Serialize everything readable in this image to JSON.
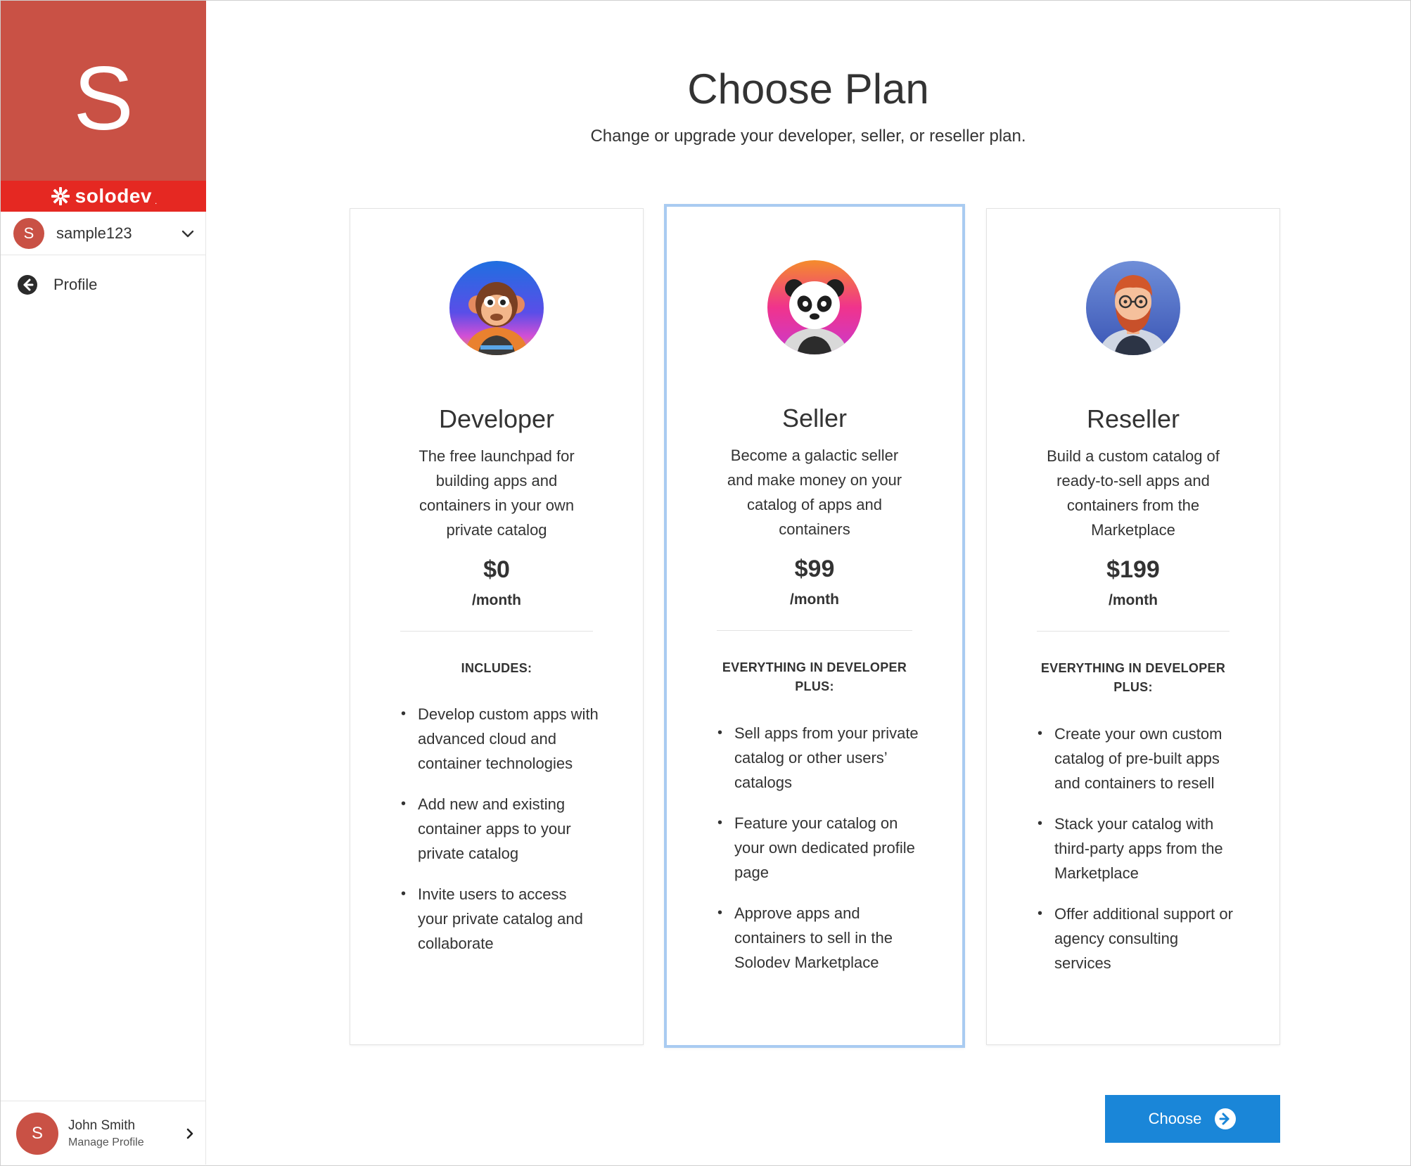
{
  "sidebar": {
    "brand_letter": "S",
    "brand_name": "solodev",
    "brand_dot": ".",
    "account": {
      "initial": "S",
      "name": "sample123"
    },
    "nav": [
      {
        "label": "Profile",
        "icon": "arrow-left-circle-icon"
      }
    ],
    "user": {
      "initial": "S",
      "name": "John Smith",
      "subtitle": "Manage Profile"
    }
  },
  "header": {
    "title": "Choose Plan",
    "subtitle": "Change or upgrade your developer, seller, or reseller plan."
  },
  "plans": [
    {
      "name": "Developer",
      "avatar": "monkey-astronaut-icon",
      "description": "The free launchpad for building apps and containers in your own private catalog",
      "price": "$0",
      "period": "/month",
      "includes_heading": "INCLUDES:",
      "features": [
        "Develop custom apps with advanced cloud and container technologies",
        "Add new and existing container apps to your private catalog",
        "Invite users to access your private catalog and collaborate"
      ],
      "selected": false
    },
    {
      "name": "Seller",
      "avatar": "panda-astronaut-icon",
      "description": "Become a galactic seller and make money on your catalog of apps and containers",
      "price": "$99",
      "period": "/month",
      "includes_heading": "EVERYTHING IN DEVELOPER PLUS:",
      "features": [
        "Sell apps from your private catalog or other users’ catalogs",
        "Feature your catalog on your own dedicated profile page",
        "Approve apps and containers to sell in the Solodev Marketplace"
      ],
      "selected": true
    },
    {
      "name": "Reseller",
      "avatar": "bearded-man-astronaut-icon",
      "description": "Build a custom catalog of ready-to-sell apps and containers from the Marketplace",
      "price": "$199",
      "period": "/month",
      "includes_heading": "EVERYTHING IN DEVELOPER PLUS:",
      "features": [
        "Create your own custom catalog of pre-built apps and containers to resell",
        "Stack your catalog with third-party apps from the Marketplace",
        "Offer additional support or agency consulting services"
      ],
      "selected": false
    }
  ],
  "actions": {
    "choose_label": "Choose",
    "choose_icon": "arrow-right-circle-icon"
  },
  "colors": {
    "brand_block": "#c95145",
    "brand_strip": "#e52822",
    "selected_border": "#a9cbf1",
    "primary_button": "#1a86d8"
  }
}
